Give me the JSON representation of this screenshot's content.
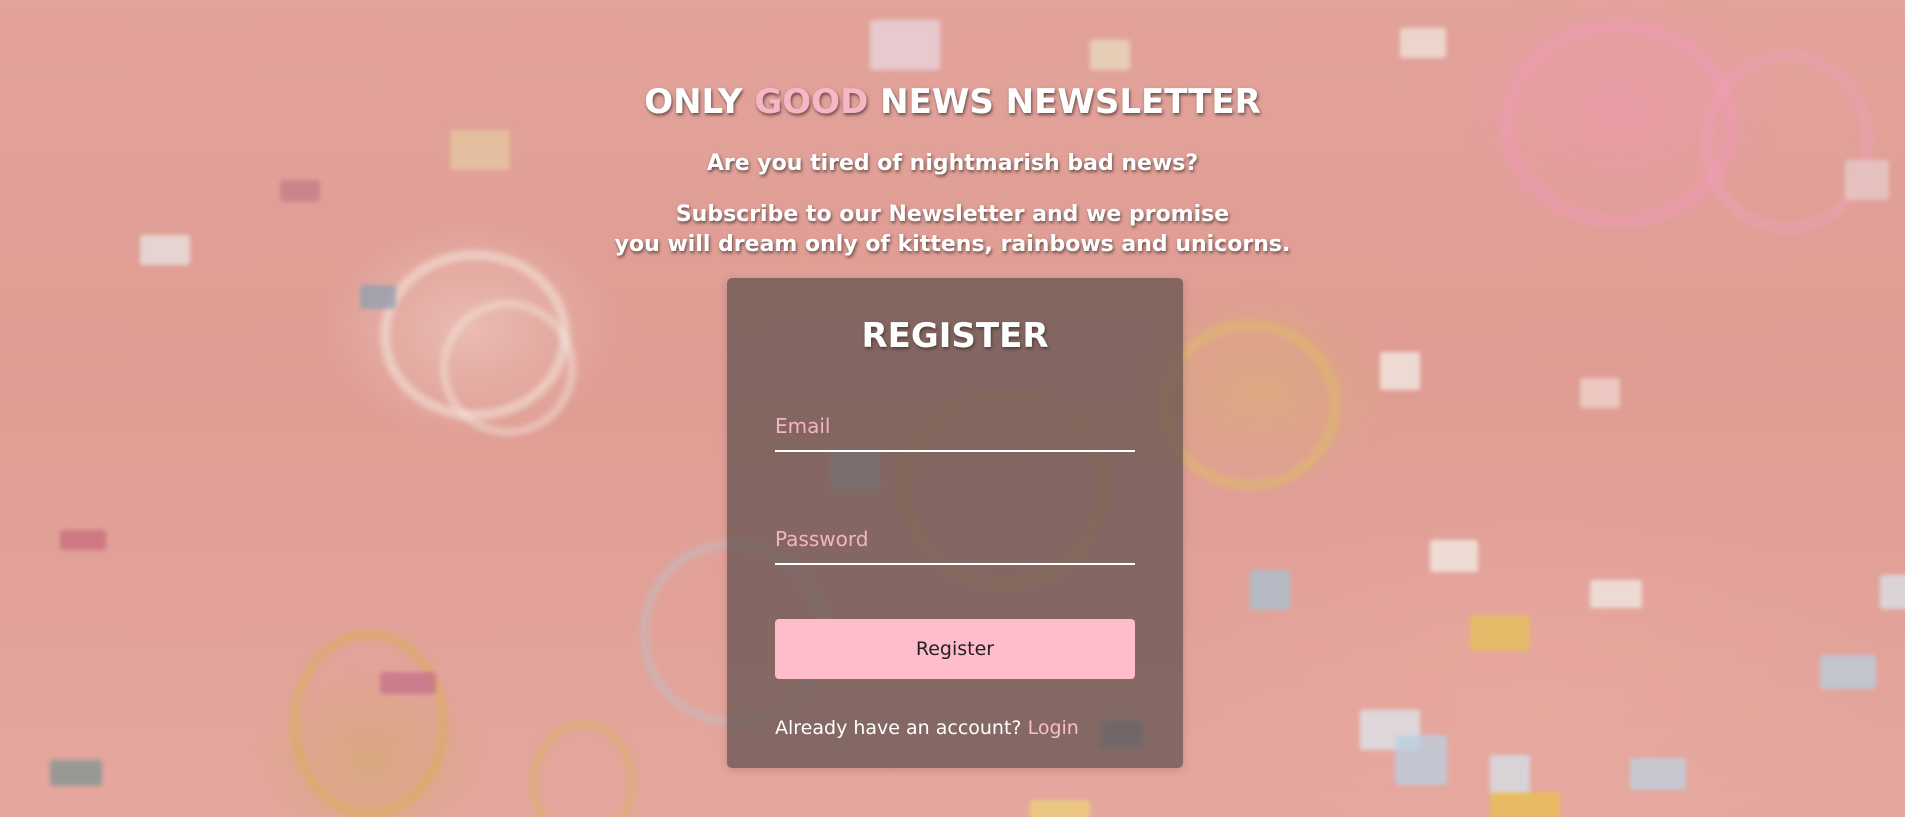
{
  "header": {
    "title_part1": "ONLY ",
    "title_accent": "GOOD",
    "title_part2": " NEWS NEWSLETTER",
    "tagline": "Are you tired of nightmarish bad news?",
    "promise_line1": "Subscribe to our Newsletter and we promise",
    "promise_line2": "you will dream only of kittens, rainbows and unicorns."
  },
  "form": {
    "title": "REGISTER",
    "email_placeholder": "Email",
    "email_value": "",
    "password_placeholder": "Password",
    "password_value": "",
    "submit_label": "Register",
    "account_prompt": "Already have an account? ",
    "login_link": "Login"
  },
  "colors": {
    "accent_pink": "#f7b6c5",
    "button_pink": "#ffbccb",
    "card_background": "rgba(95, 80, 78, 0.72)",
    "page_background": "#e2a39b"
  }
}
